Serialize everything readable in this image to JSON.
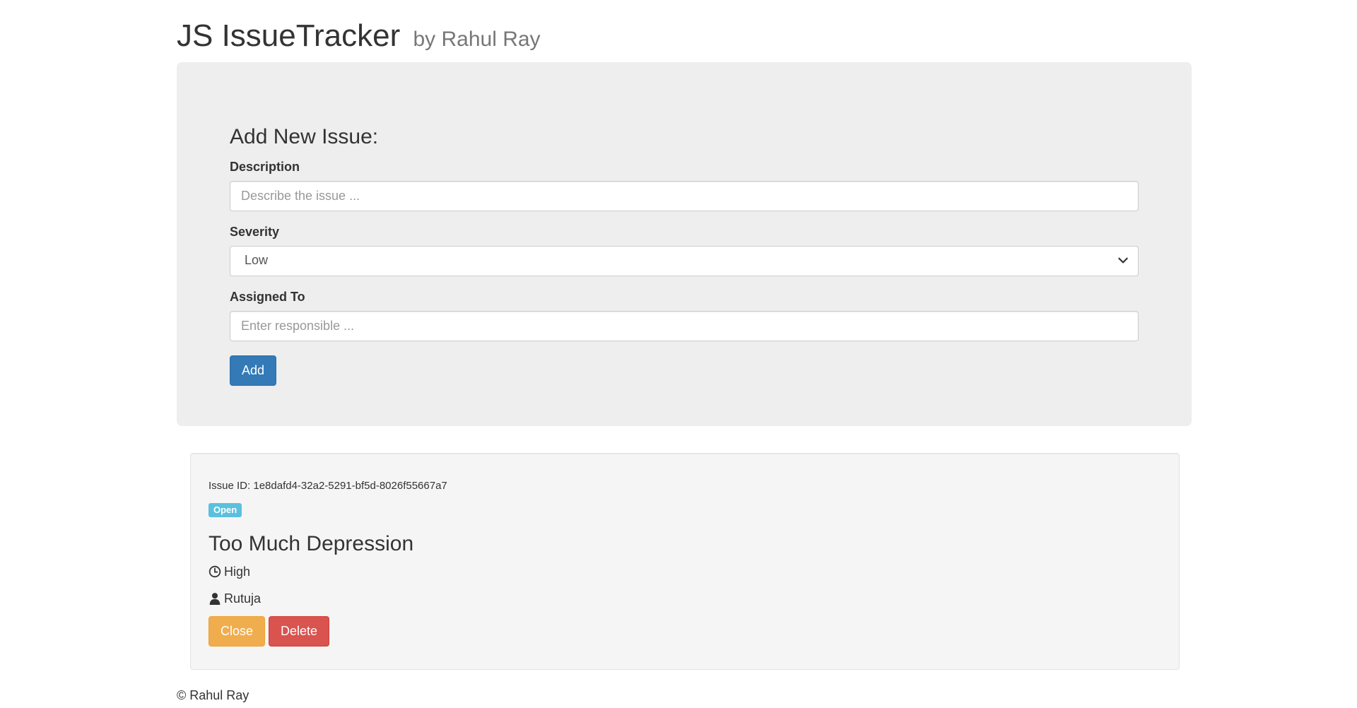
{
  "header": {
    "title": "JS IssueTracker",
    "subtitle": "by Rahul Ray"
  },
  "form": {
    "heading": "Add New Issue:",
    "description": {
      "label": "Description",
      "placeholder": "Describe the issue ...",
      "value": ""
    },
    "severity": {
      "label": "Severity",
      "selected": "Low"
    },
    "assigned_to": {
      "label": "Assigned To",
      "placeholder": "Enter responsible ...",
      "value": ""
    },
    "add_label": "Add"
  },
  "issues": [
    {
      "id_label": "Issue ID: 1e8dafd4-32a2-5291-bf5d-8026f55667a7",
      "status": "Open",
      "title": "Too Much Depression",
      "severity": "High",
      "assignee": "Rutuja",
      "close_label": "Close",
      "delete_label": "Delete"
    }
  ],
  "footer": {
    "text": "© Rahul Ray"
  },
  "colors": {
    "primary": "#337ab7",
    "warning": "#f0ad4e",
    "danger": "#d9534f",
    "info": "#5bc0de"
  },
  "icons": {
    "severity": "time-icon",
    "assignee": "user-icon",
    "select": "chevron-down-icon"
  }
}
